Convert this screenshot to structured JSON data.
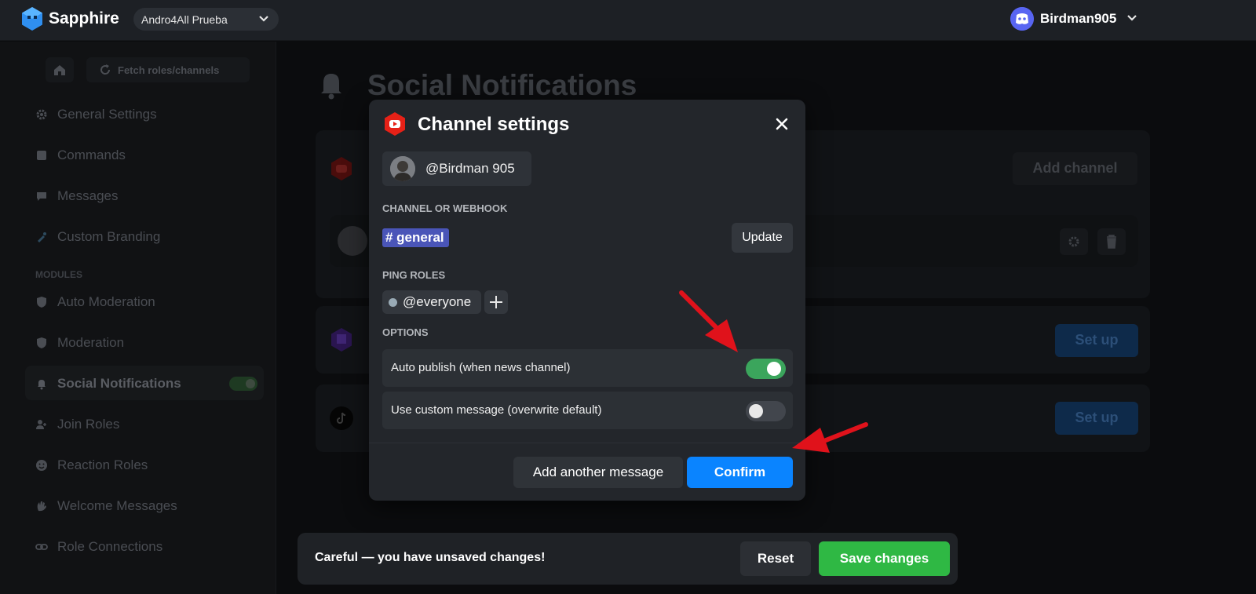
{
  "app": {
    "brand": "Sapphire",
    "server": "Andro4All Prueba",
    "user": "Birdman905"
  },
  "sidebar": {
    "home_icon": "home-icon",
    "fetch_label": "Fetch roles/channels",
    "modules_label": "MODULES",
    "items": [
      {
        "label": "General Settings",
        "icon": "gear-icon"
      },
      {
        "label": "Commands",
        "icon": "command-icon"
      },
      {
        "label": "Messages",
        "icon": "chat-icon"
      },
      {
        "label": "Custom Branding",
        "icon": "brush-icon"
      },
      {
        "label": "Auto Moderation",
        "icon": "shield-icon"
      },
      {
        "label": "Moderation",
        "icon": "shield-icon"
      },
      {
        "label": "Social Notifications",
        "icon": "bell-icon",
        "active": true,
        "enabled": true
      },
      {
        "label": "Join Roles",
        "icon": "user-add-icon"
      },
      {
        "label": "Reaction Roles",
        "icon": "smile-icon"
      },
      {
        "label": "Welcome Messages",
        "icon": "wave-icon"
      },
      {
        "label": "Role Connections",
        "icon": "link-icon"
      }
    ]
  },
  "main": {
    "title": "Social Notifications",
    "add_channel": "Add channel",
    "setup_label": "Set up"
  },
  "modal": {
    "title": "Channel settings",
    "account": "@Birdman 905",
    "channel_section": "CHANNEL OR WEBHOOK",
    "channel": "# general",
    "update": "Update",
    "ping_section": "PING ROLES",
    "role": "@everyone",
    "options_section": "OPTIONS",
    "options": [
      {
        "label": "Auto publish (when news channel)",
        "enabled": true
      },
      {
        "label": "Use custom message (overwrite default)",
        "enabled": false
      }
    ],
    "add_message": "Add another message",
    "confirm": "Confirm"
  },
  "unsaved": {
    "message": "Careful — you have unsaved changes!",
    "reset": "Reset",
    "save": "Save changes"
  },
  "colors": {
    "accent": "#0a84ff",
    "success": "#3ba55c",
    "youtube": "#e62117",
    "discord": "#5865f2",
    "arrow": "#e0121b"
  }
}
